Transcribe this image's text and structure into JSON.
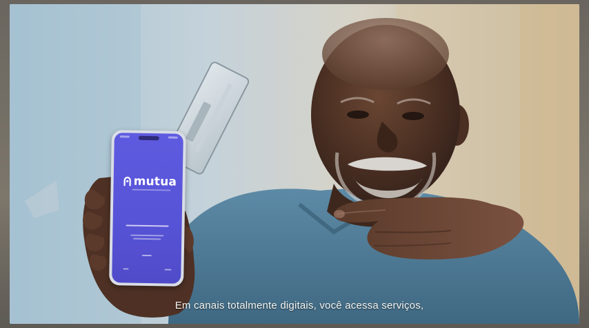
{
  "app": {
    "logo_text": "mutua",
    "brand_color": "#5b57dd"
  },
  "subtitle": {
    "text": "Em canais totalmente digitais, você acessa serviços,"
  },
  "icons": {
    "logo_mark": "mutua-logo-icon"
  }
}
